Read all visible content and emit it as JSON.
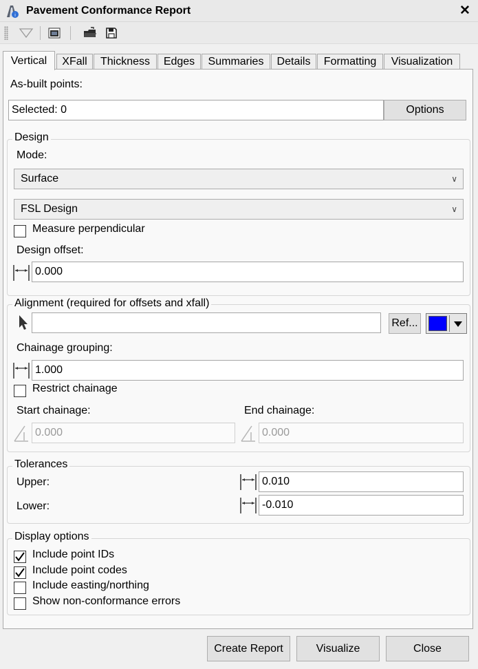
{
  "window": {
    "title": "Pavement Conformance Report",
    "close_label": "✕"
  },
  "tabs": [
    "Vertical",
    "XFall",
    "Thickness",
    "Edges",
    "Summaries",
    "Details",
    "Formatting",
    "Visualization"
  ],
  "active_tab": "Vertical",
  "asbuilt": {
    "label": "As-built points:",
    "selected_text": "Selected: 0",
    "options_label": "Options"
  },
  "design": {
    "group_label": "Design",
    "mode_label": "Mode:",
    "mode_value": "Surface",
    "surface_value": "FSL Design",
    "measure_perpendicular_label": "Measure perpendicular",
    "measure_perpendicular_checked": false,
    "offset_label": "Design offset:",
    "offset_value": "0.000"
  },
  "alignment": {
    "group_label": "Alignment (required for offsets and xfall)",
    "value": "",
    "ref_label": "Ref...",
    "color": "#0000ff",
    "grouping_label": "Chainage grouping:",
    "grouping_value": "1.000",
    "restrict_label": "Restrict chainage",
    "restrict_checked": false,
    "start_label": "Start chainage:",
    "start_value": "0.000",
    "end_label": "End chainage:",
    "end_value": "0.000"
  },
  "tolerances": {
    "group_label": "Tolerances",
    "upper_label": "Upper:",
    "upper_value": "0.010",
    "lower_label": "Lower:",
    "lower_value": "-0.010"
  },
  "display_options": {
    "group_label": "Display options",
    "items": [
      {
        "label": "Include point IDs",
        "checked": true
      },
      {
        "label": "Include point codes",
        "checked": true
      },
      {
        "label": "Include easting/northing",
        "checked": false
      },
      {
        "label": "Show non-conformance errors",
        "checked": false
      }
    ]
  },
  "buttons": {
    "create_report": "Create Report",
    "visualize": "Visualize",
    "close": "Close"
  },
  "icons": {
    "app": "pavement-app-icon",
    "filter": "filter-icon",
    "view": "view-window-icon",
    "open": "open-folder-icon",
    "save": "save-icon",
    "pick": "arrow-pointer-icon",
    "distance": "horizontal-distance-icon",
    "chainage": "chainage-angle-icon"
  }
}
